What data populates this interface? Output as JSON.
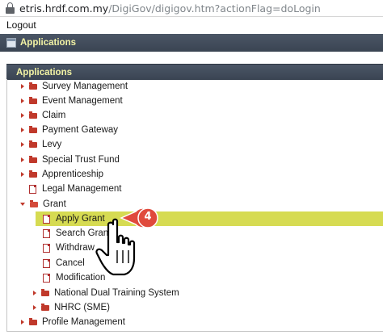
{
  "browser": {
    "url_host": "etris.hrdf.com.my",
    "url_path": "/DigiGov/digigov.htm?actionFlag=doLogin"
  },
  "header": {
    "logout_label": "Logout",
    "section_title": "Applications"
  },
  "panel": {
    "title": "Applications"
  },
  "tree": [
    {
      "label": "Survey Management",
      "kind": "folder",
      "expanded": false
    },
    {
      "label": "Event Management",
      "kind": "folder",
      "expanded": false
    },
    {
      "label": "Claim",
      "kind": "folder",
      "expanded": false
    },
    {
      "label": "Payment Gateway",
      "kind": "folder",
      "expanded": false
    },
    {
      "label": "Levy",
      "kind": "folder",
      "expanded": false
    },
    {
      "label": "Special Trust Fund",
      "kind": "folder",
      "expanded": false
    },
    {
      "label": "Apprenticeship",
      "kind": "folder",
      "expanded": false
    },
    {
      "label": "Legal Management",
      "kind": "document"
    },
    {
      "label": "Grant",
      "kind": "folder",
      "expanded": true
    },
    {
      "label": "Apply Grant",
      "kind": "document",
      "selected": true
    },
    {
      "label": "Search Grant",
      "kind": "document"
    },
    {
      "label": "Withdraw",
      "kind": "document"
    },
    {
      "label": "Cancel",
      "kind": "document"
    },
    {
      "label": "Modification",
      "kind": "document"
    },
    {
      "label": "National Dual Training System",
      "kind": "folder",
      "expanded": false
    },
    {
      "label": "NHRC (SME)",
      "kind": "folder",
      "expanded": false
    },
    {
      "label": "Profile Management",
      "kind": "folder",
      "expanded": false
    }
  ],
  "callout": {
    "step": "4",
    "color": "#e04a3c"
  },
  "colors": {
    "header_bar": "#3a4452",
    "header_text": "#f2f2a4",
    "highlight": "#d6db52",
    "folder": "#c0392b"
  },
  "icons": [
    "lock-icon",
    "window-icon",
    "folder-icon",
    "document-icon",
    "caret-icon",
    "pointer-hand-icon"
  ]
}
